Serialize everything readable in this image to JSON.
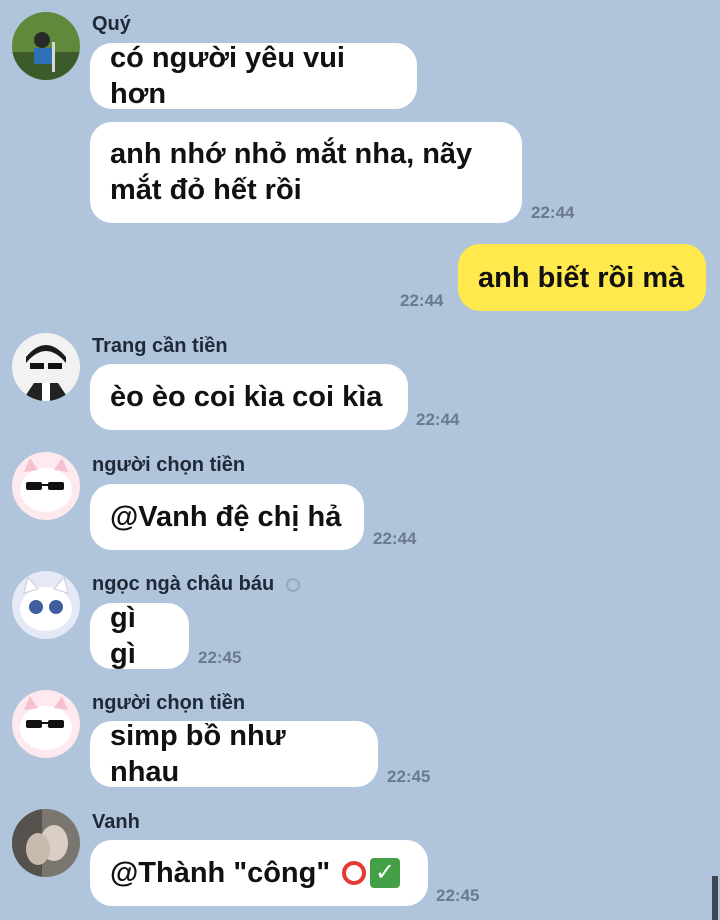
{
  "messages": [
    {
      "sender": "Quý",
      "text": "có người yêu vui hơn"
    },
    {
      "text_line1": "anh nhớ nhỏ mắt nha, nãy",
      "text_line2": "mắt đỏ hết rồi",
      "time": "22:44"
    },
    {
      "mine": true,
      "text": "anh biết rồi mà",
      "time": "22:44"
    },
    {
      "sender": "Trang cần tiền",
      "text": "èo èo coi kìa coi kìa",
      "time": "22:44"
    },
    {
      "sender": "người chọn tiền",
      "text": "@Vanh đệ chị hả",
      "time": "22:44"
    },
    {
      "sender": "ngọc ngà châu báu",
      "sender_icon": "ring-icon",
      "text": "gì gì",
      "time": "22:45"
    },
    {
      "sender": "người chọn tiền",
      "text": "simp bồ như nhau",
      "time": "22:45"
    },
    {
      "sender": "Vanh",
      "text": "@Thành \"công\"",
      "emoji": [
        "red-circle-icon",
        "check-mark-icon"
      ],
      "time": "22:45"
    }
  ],
  "colors": {
    "background": "#b0c4dc",
    "bubble_other": "#ffffff",
    "bubble_mine": "#ffe94d"
  }
}
